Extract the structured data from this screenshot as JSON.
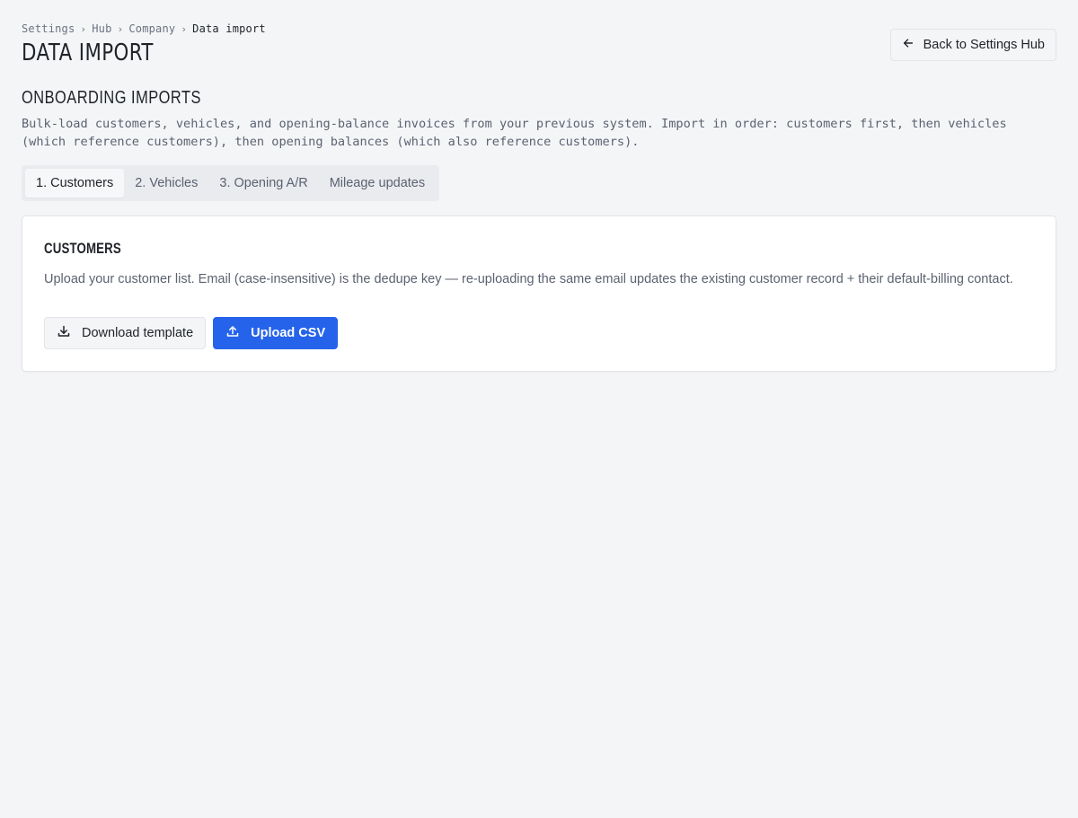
{
  "breadcrumb": {
    "items": [
      "Settings",
      "Hub",
      "Company"
    ],
    "current": "Data import",
    "separator": "›"
  },
  "page": {
    "title": "DATA IMPORT",
    "back_label": "Back to Settings Hub"
  },
  "section": {
    "title": "ONBOARDING IMPORTS",
    "description": "Bulk-load customers, vehicles, and opening-balance invoices from your previous system. Import in order: customers first, then vehicles (which reference customers), then opening balances (which also reference customers)."
  },
  "tabs": [
    {
      "label": "1. Customers",
      "active": true
    },
    {
      "label": "2. Vehicles",
      "active": false
    },
    {
      "label": "3. Opening A/R",
      "active": false
    },
    {
      "label": "Mileage updates",
      "active": false
    }
  ],
  "card": {
    "title": "CUSTOMERS",
    "description": "Upload your customer list. Email (case-insensitive) is the dedupe key — re-uploading the same email updates the existing customer record + their default-billing contact.",
    "download_label": "Download template",
    "upload_label": "Upload CSV"
  },
  "colors": {
    "accent": "#2563eb",
    "background": "#f4f5f7"
  },
  "icons": {
    "back": "arrow-left-icon",
    "download": "download-icon",
    "upload": "upload-icon"
  }
}
